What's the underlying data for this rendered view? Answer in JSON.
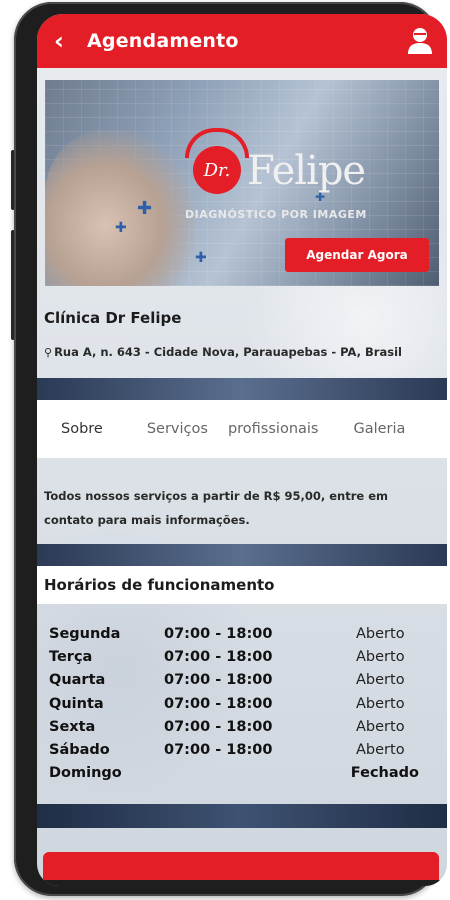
{
  "appbar": {
    "back_icon": "‹",
    "title": "Agendamento",
    "profile_icon": "user-icon"
  },
  "banner": {
    "logo_initials": "Dr.",
    "logo_name": "Felipe",
    "logo_subtitle": "DIAGNÓSTICO POR IMAGEM",
    "cta_label": "Agendar Agora"
  },
  "clinic": {
    "name": "Clínica Dr Felipe",
    "address": "Rua A, n. 643 - Cidade Nova, Parauapebas - PA, Brasil"
  },
  "tabs": [
    "Sobre",
    "Serviços",
    "profissionais",
    "Galeria"
  ],
  "about": {
    "text": "Todos nossos serviços a partir de R$ 95,00, entre em contato para mais informações."
  },
  "hours": {
    "title": "Horários de funcionamento",
    "rows": [
      {
        "day": "Segunda",
        "time": "07:00 - 18:00",
        "status": "Aberto"
      },
      {
        "day": "Terça",
        "time": "07:00 - 18:00",
        "status": "Aberto"
      },
      {
        "day": "Quarta",
        "time": "07:00 - 18:00",
        "status": "Aberto"
      },
      {
        "day": "Quinta",
        "time": "07:00 - 18:00",
        "status": "Aberto"
      },
      {
        "day": "Sexta",
        "time": "07:00 - 18:00",
        "status": "Aberto"
      },
      {
        "day": "Sábado",
        "time": "07:00 - 18:00",
        "status": "Aberto"
      },
      {
        "day": "Domingo",
        "time": "",
        "status": "Fechado"
      }
    ]
  },
  "colors": {
    "brand_red": "#e41e26",
    "text_dark": "#1c1c1c"
  }
}
